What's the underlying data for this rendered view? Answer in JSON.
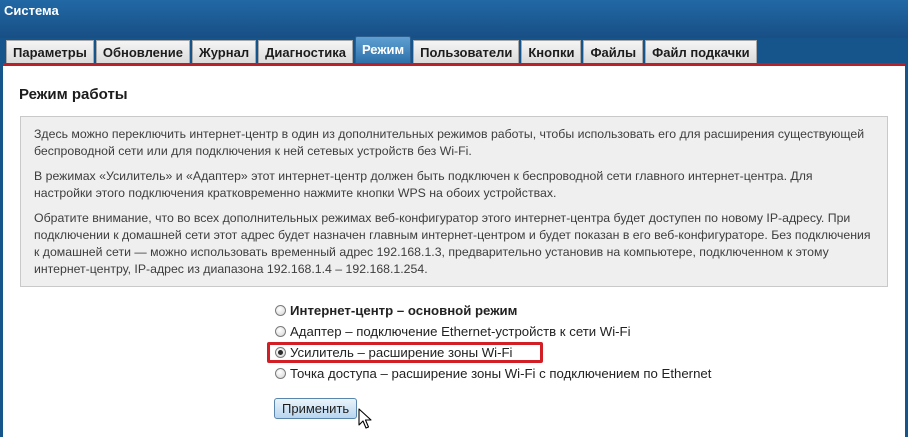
{
  "app": {
    "title": "Система"
  },
  "tabs": [
    {
      "label": "Параметры",
      "active": false
    },
    {
      "label": "Обновление",
      "active": false
    },
    {
      "label": "Журнал",
      "active": false
    },
    {
      "label": "Диагностика",
      "active": false
    },
    {
      "label": "Режим",
      "active": true
    },
    {
      "label": "Пользователи",
      "active": false
    },
    {
      "label": "Кнопки",
      "active": false
    },
    {
      "label": "Файлы",
      "active": false
    },
    {
      "label": "Файл подкачки",
      "active": false
    }
  ],
  "section": {
    "title": "Режим работы"
  },
  "info": {
    "paragraphs": [
      "Здесь можно переключить интернет-центр в один из дополнительных режимов работы, чтобы использовать его для расширения существующей беспроводной сети или для подключения к ней сетевых устройств без Wi-Fi.",
      "В режимах «Усилитель» и «Адаптер» этот интернет-центр должен быть подключен к беспроводной сети главного интернет-центра. Для настройки этого подключения кратковременно нажмите кнопки WPS на обоих устройствах.",
      "Обратите внимание, что во всех дополнительных режимах веб-конфигуратор этого интернет-центра будет доступен по новому IP-адресу. При подключении к домашней сети этот адрес будет назначен главным интернет-центром и будет показан в его веб-конфигураторе. Без подключения к домашней сети — можно использовать временный адрес 192.168.1.3, предварительно установив на компьютере, подключенном к этому интернет-центру, IP-адрес из диапазона 192.168.1.4 – 192.168.1.254."
    ]
  },
  "modes": {
    "selected_index": 2,
    "options": [
      {
        "label": "Интернет-центр – основной режим",
        "bold": true
      },
      {
        "label": "Адаптер – подключение Ethernet-устройств к сети Wi-Fi",
        "bold": false
      },
      {
        "label": "Усилитель – расширение зоны Wi-Fi",
        "bold": false
      },
      {
        "label": "Точка доступа – расширение зоны Wi-Fi с подключением по Ethernet",
        "bold": false
      }
    ]
  },
  "actions": {
    "apply_label": "Применить"
  },
  "icons": {
    "cursor": "mouse-pointer-icon"
  },
  "colors": {
    "header_blue": "#16558b",
    "active_tab": "#2c6fa8",
    "accent_red": "#b8212a",
    "highlight_red": "#d21f25"
  }
}
